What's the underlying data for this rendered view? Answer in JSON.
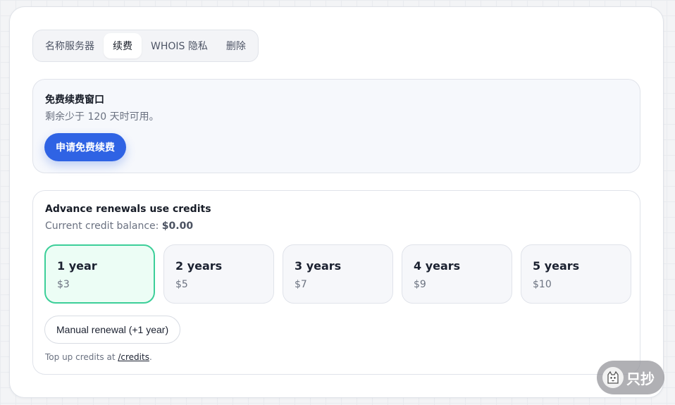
{
  "tabs": [
    {
      "label": "名称服务器",
      "active": false
    },
    {
      "label": "续费",
      "active": true
    },
    {
      "label": "WHOIS 隐私",
      "active": false
    },
    {
      "label": "删除",
      "active": false
    }
  ],
  "free_window": {
    "title": "免费续费窗口",
    "subtitle": "剩余少于 120 天时可用。",
    "button_label": "申请免费续费"
  },
  "advance": {
    "title": "Advance renewals use credits",
    "balance_label": "Current credit balance: ",
    "balance_value": "$0.00",
    "options": [
      {
        "years": "1 year",
        "price": "$3",
        "selected": true
      },
      {
        "years": "2 years",
        "price": "$5",
        "selected": false
      },
      {
        "years": "3 years",
        "price": "$7",
        "selected": false
      },
      {
        "years": "4 years",
        "price": "$9",
        "selected": false
      },
      {
        "years": "5 years",
        "price": "$10",
        "selected": false
      }
    ],
    "manual_button_label": "Manual renewal (+1 year)",
    "footer_prefix": "Top up credits at ",
    "footer_link": "/credits",
    "footer_suffix": "."
  },
  "watermark": {
    "text": "只抄",
    "icon": "cat-icon"
  },
  "colors": {
    "primary": "#2f63e4",
    "selected_border": "#3ccf99",
    "selected_bg": "#ecfdf5"
  }
}
